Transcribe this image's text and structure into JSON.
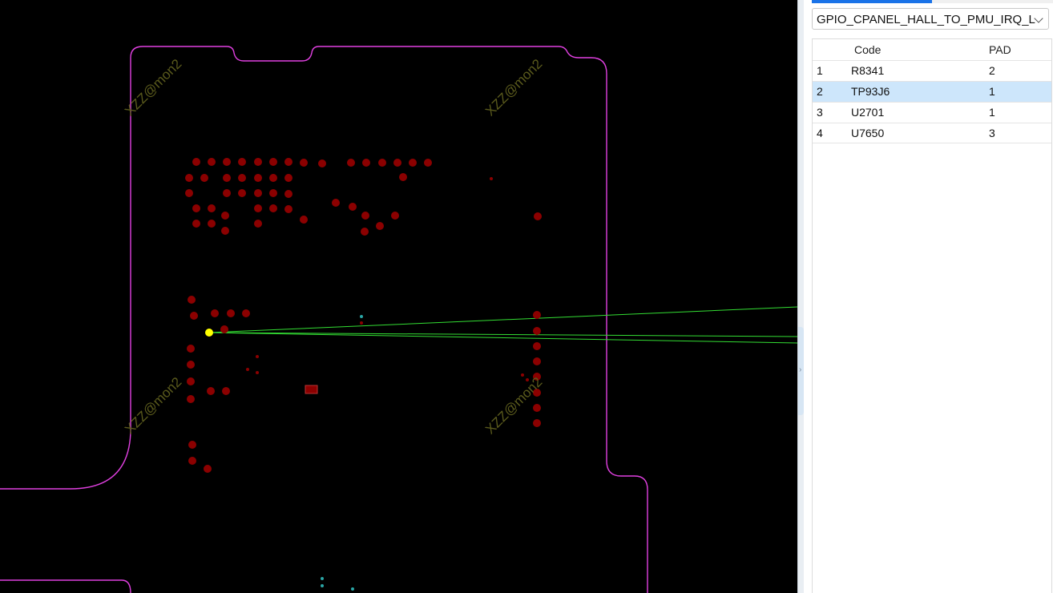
{
  "watermark": "XZZ@mon2",
  "colors": {
    "background": "#000000",
    "outline": "#e040e0",
    "pad": "#8b0000",
    "selected_pad": "#ffff00",
    "ratsnest": "#33dd33",
    "via": "#2aa6a6",
    "selection_row": "#cde6fb",
    "tab_accent": "#1a73e8"
  },
  "panel": {
    "net_select": {
      "value": "GPIO_CPANEL_HALL_TO_PMU_IRQ_L",
      "icon": "chevron-down-icon"
    },
    "table": {
      "columns": [
        "",
        "Code",
        "PAD"
      ],
      "rows": [
        {
          "index": "1",
          "code": "R8341",
          "pad": "2",
          "selected": false
        },
        {
          "index": "2",
          "code": "TP93J6",
          "pad": "1",
          "selected": true
        },
        {
          "index": "3",
          "code": "U2701",
          "pad": "1",
          "selected": false
        },
        {
          "index": "4",
          "code": "U7650",
          "pad": "3",
          "selected": false
        }
      ]
    }
  },
  "splitter": {
    "icon": "chevron-right-icon",
    "glyph": "›"
  }
}
